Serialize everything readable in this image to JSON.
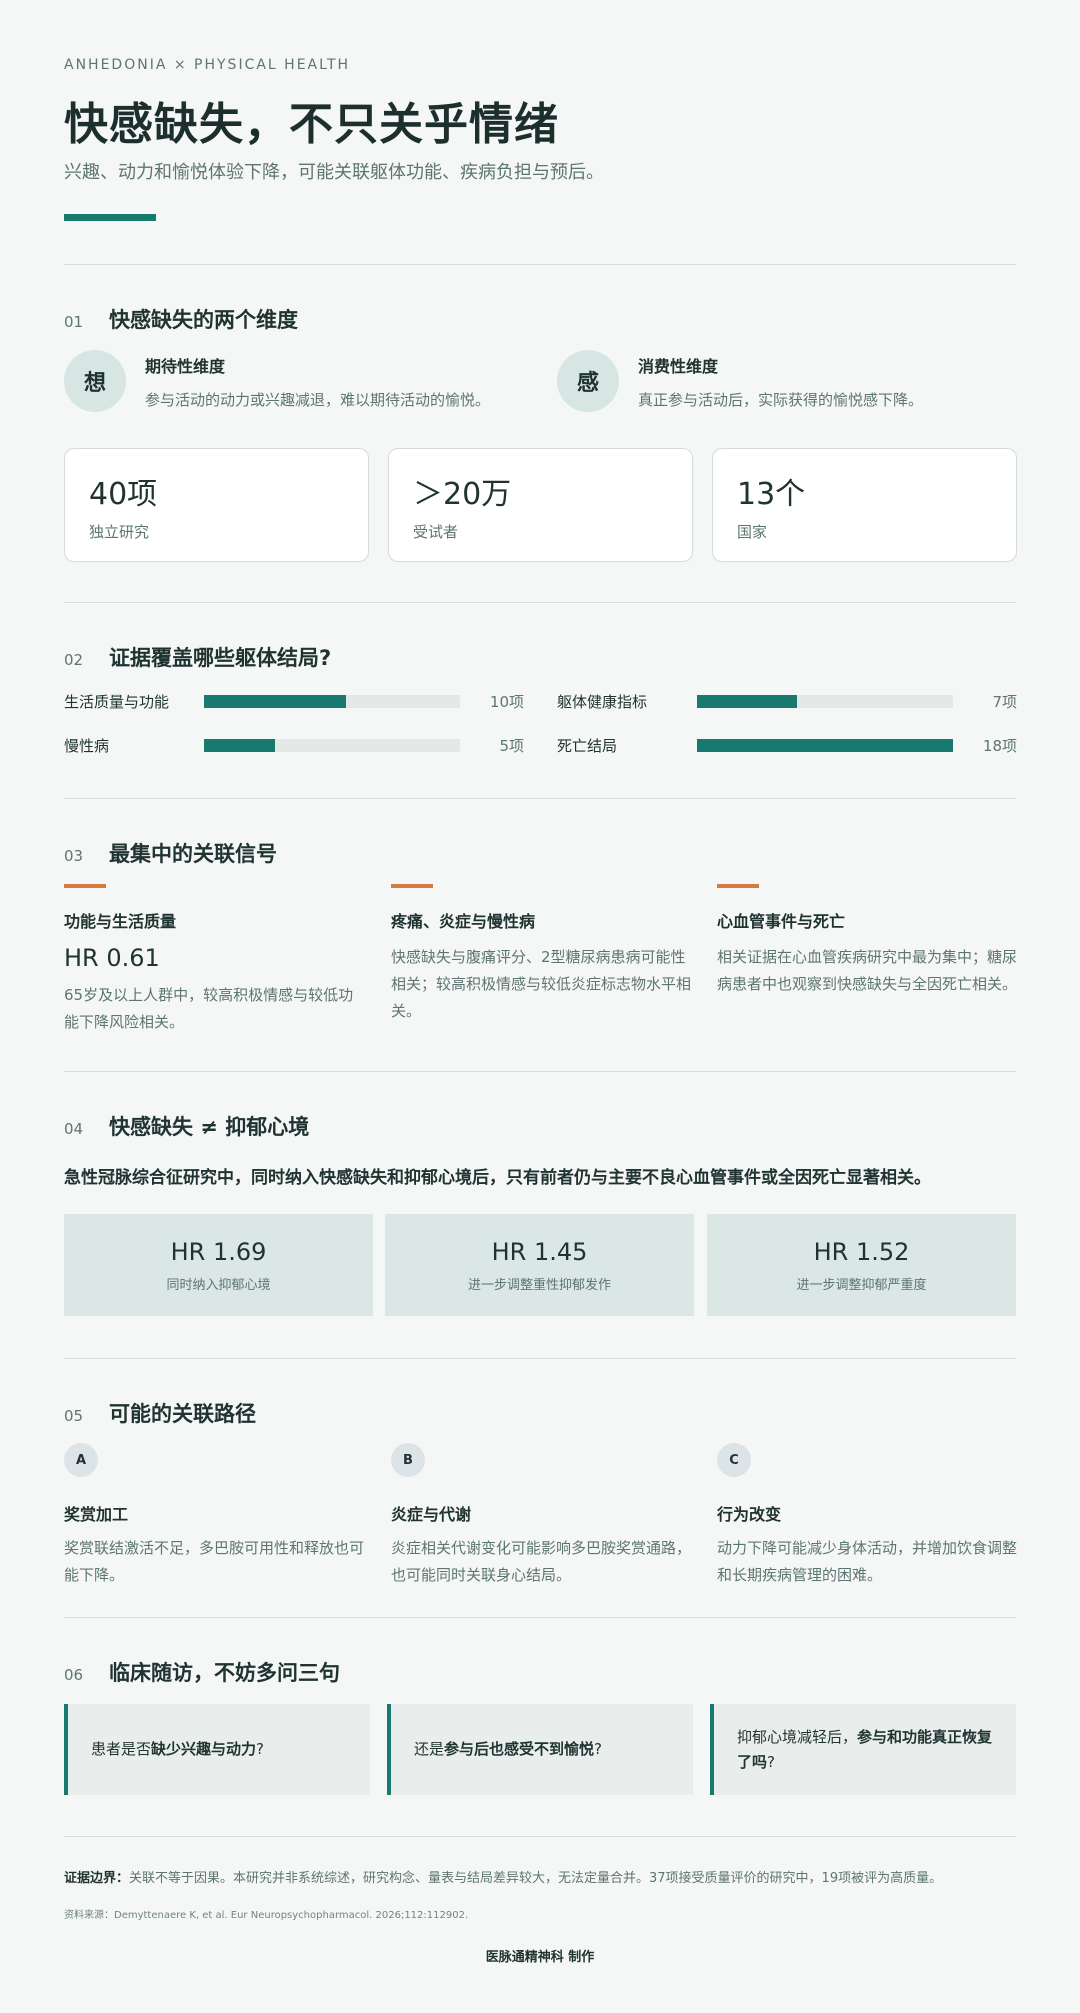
{
  "header": {
    "kicker": "ANHEDONIA × PHYSICAL HEALTH",
    "title": "快感缺失，不只关乎情绪",
    "subtitle": "兴趣、动力和愉悦体验下降，可能关联躯体功能、疾病负担与预后。"
  },
  "section1": {
    "num": "01",
    "title": "快感缺失的两个维度",
    "dimensions": [
      {
        "badge": "想",
        "title": "期待性维度",
        "desc": "参与活动的动力或兴趣减退，难以期待活动的愉悦。"
      },
      {
        "badge": "感",
        "title": "消费性维度",
        "desc": "真正参与活动后，实际获得的愉悦感下降。"
      }
    ],
    "stats": [
      {
        "value": "40项",
        "label": "独立研究"
      },
      {
        "value": "＞20万",
        "label": "受试者"
      },
      {
        "value": "13个",
        "label": "国家"
      }
    ]
  },
  "section2": {
    "num": "02",
    "title": "证据覆盖哪些躯体结局?",
    "max": 18,
    "bars": [
      {
        "label": "生活质量与功能",
        "value": 10,
        "count": "10项"
      },
      {
        "label": "躯体健康指标",
        "value": 7,
        "count": "7项"
      },
      {
        "label": "慢性病",
        "value": 5,
        "count": "5项"
      },
      {
        "label": "死亡结局",
        "value": 18,
        "count": "18项"
      }
    ]
  },
  "section3": {
    "num": "03",
    "title": "最集中的关联信号",
    "signals": [
      {
        "title": "功能与生活质量",
        "hr": "HR 0.61",
        "desc": "65岁及以上人群中，较高积极情感与较低功能下降风险相关。"
      },
      {
        "title": "疼痛、炎症与慢性病",
        "desc": "快感缺失与腹痛评分、2型糖尿病患病可能性相关；较高积极情感与较低炎症标志物水平相关。"
      },
      {
        "title": "心血管事件与死亡",
        "desc": "相关证据在心血管疾病研究中最为集中；糖尿病患者中也观察到快感缺失与全因死亡相关。"
      }
    ]
  },
  "section4": {
    "num": "04",
    "title": "快感缺失 ≠ 抑郁心境",
    "lead": "急性冠脉综合征研究中，同时纳入快感缺失和抑郁心境后，只有前者仍与主要不良心血管事件或全因死亡显著相关。",
    "boxes": [
      {
        "value": "HR 1.69",
        "note": "同时纳入抑郁心境"
      },
      {
        "value": "HR 1.45",
        "note": "进一步调整重性抑郁发作"
      },
      {
        "value": "HR 1.52",
        "note": "进一步调整抑郁严重度"
      }
    ]
  },
  "section5": {
    "num": "05",
    "title": "可能的关联路径",
    "paths": [
      {
        "badge": "A",
        "title": "奖赏加工",
        "desc": "奖赏联结激活不足，多巴胺可用性和释放也可能下降。"
      },
      {
        "badge": "B",
        "title": "炎症与代谢",
        "desc": "炎症相关代谢变化可能影响多巴胺奖赏通路，也可能同时关联身心结局。"
      },
      {
        "badge": "C",
        "title": "行为改变",
        "desc": "动力下降可能减少身体活动，并增加饮食调整和长期疾病管理的困难。"
      }
    ]
  },
  "section6": {
    "num": "06",
    "title": "临床随访，不妨多问三句",
    "questions": [
      {
        "pre": "患者是否",
        "bold": "缺少兴趣与动力",
        "post": "?"
      },
      {
        "pre": "还是",
        "bold": "参与后也感受不到愉悦",
        "post": "?"
      },
      {
        "pre": "抑郁心境减轻后，",
        "bold": "参与和功能真正恢复了吗",
        "post": "?"
      }
    ]
  },
  "footer": {
    "evidence_label": "证据边界：",
    "evidence_text": "关联不等于因果。本研究并非系统综述，研究构念、量表与结局差异较大，无法定量合并。37项接受质量评价的研究中，19项被评为高质量。",
    "source": "资料来源：Demyttenaere K, et al. Eur Neuropsychopharmacol. 2026;112:112902.",
    "maker": "医脉通精神科 制作"
  },
  "colors": {
    "accent": "#187a6e",
    "orange": "#d47c3f",
    "background": "#f5f7f6"
  }
}
